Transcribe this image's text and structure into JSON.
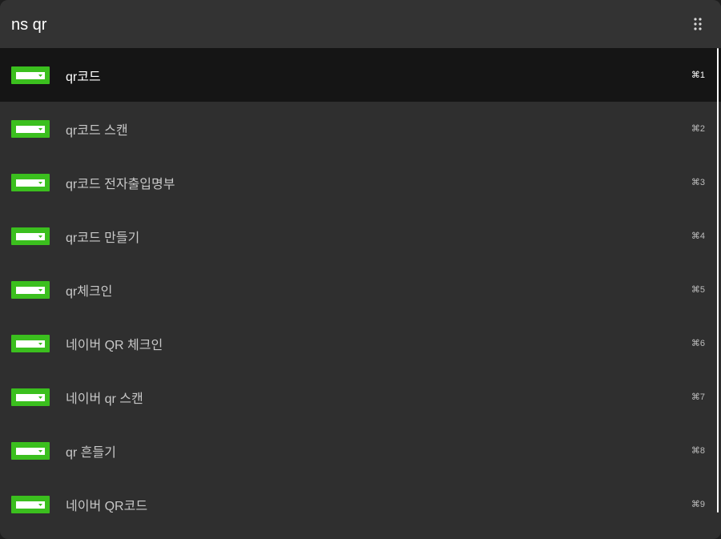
{
  "search": {
    "value": "ns qr",
    "menu_icon": "grid-dots-icon"
  },
  "results": [
    {
      "label": "qr코드",
      "shortcut": "⌘1",
      "icon": "naver-search-app-icon",
      "selected": true
    },
    {
      "label": "qr코드 스캔",
      "shortcut": "⌘2",
      "icon": "naver-search-app-icon"
    },
    {
      "label": "qr코드 전자출입명부",
      "shortcut": "⌘3",
      "icon": "naver-search-app-icon"
    },
    {
      "label": "qr코드 만들기",
      "shortcut": "⌘4",
      "icon": "naver-search-app-icon"
    },
    {
      "label": "qr체크인",
      "shortcut": "⌘5",
      "icon": "naver-search-app-icon"
    },
    {
      "label": "네이버 QR 체크인",
      "shortcut": "⌘6",
      "icon": "naver-search-app-icon"
    },
    {
      "label": "네이버 qr 스캔",
      "shortcut": "⌘7",
      "icon": "naver-search-app-icon"
    },
    {
      "label": "qr 흔들기",
      "shortcut": "⌘8",
      "icon": "naver-search-app-icon"
    },
    {
      "label": "네이버 QR코드",
      "shortcut": "⌘9",
      "icon": "naver-search-app-icon"
    }
  ],
  "colors": {
    "background": "#2f2f2f",
    "selected_row": "#151515",
    "icon_green": "#3bbf1e"
  }
}
